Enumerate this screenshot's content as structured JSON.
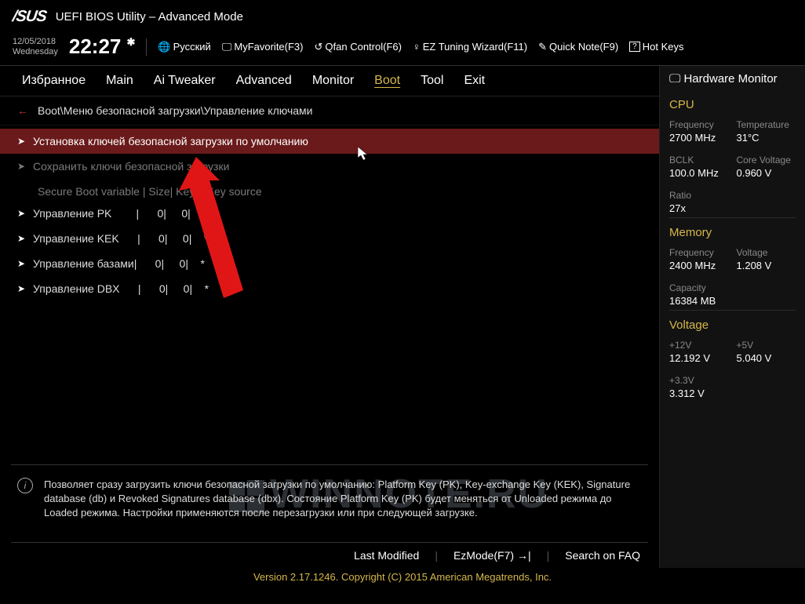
{
  "header": {
    "logo": "/SUS",
    "title": "UEFI BIOS Utility – Advanced Mode"
  },
  "topbar": {
    "date": "12/05/2018",
    "day": "Wednesday",
    "time": "22:27",
    "language": "Русский",
    "links": {
      "favorite": "MyFavorite(F3)",
      "qfan": "Qfan Control(F6)",
      "eztune": "EZ Tuning Wizard(F11)",
      "quicknote": "Quick Note(F9)",
      "hotkeys": "Hot Keys"
    }
  },
  "tabs": {
    "items": [
      "Избранное",
      "Main",
      "Ai Tweaker",
      "Advanced",
      "Monitor",
      "Boot",
      "Tool",
      "Exit"
    ],
    "active": "Boot"
  },
  "breadcrumb": "Boot\\Меню безопасной загрузки\\Управление ключами",
  "rows": {
    "selected": "Установка ключей безопасной загрузки по умолчанию",
    "disabled": "Сохранить ключи безопасной загрузки",
    "table_header": "Secure Boot variable |  Size| Key#| Key source",
    "pk": "Управление PK        |      0|     0|    *",
    "kek": "Управление KEK      |      0|     0|    *",
    "db": "Управление базами|      0|     0|    *",
    "dbx": "Управление DBX      |      0|     0|    *"
  },
  "help": "Позволяет сразу загрузить ключи безопасной загрузки по умолчанию: Platform Key (PK), Key-exchange Key (KEK), Signature database (db) и Revoked Signatures database (dbx). Состояние Platform Key (PK) будет меняться от Unloaded режима до Loaded режима. Настройки применяются после перезагрузки или при следующей загрузке.",
  "footer": {
    "last_modified": "Last Modified",
    "ezmode": "EzMode(F7)",
    "search": "Search on FAQ",
    "copyright": "Version 2.17.1246. Copyright (C) 2015 American Megatrends, Inc."
  },
  "hw": {
    "title": "Hardware Monitor",
    "cpu": {
      "title": "CPU",
      "freq_label": "Frequency",
      "freq": "2700 MHz",
      "temp_label": "Temperature",
      "temp": "31°C",
      "bclk_label": "BCLK",
      "bclk": "100.0 MHz",
      "vcore_label": "Core Voltage",
      "vcore": "0.960 V",
      "ratio_label": "Ratio",
      "ratio": "27x"
    },
    "memory": {
      "title": "Memory",
      "freq_label": "Frequency",
      "freq": "2400 MHz",
      "volt_label": "Voltage",
      "volt": "1.208 V",
      "cap_label": "Capacity",
      "cap": "16384 MB"
    },
    "voltage": {
      "title": "Voltage",
      "v12_label": "+12V",
      "v12": "12.192 V",
      "v5_label": "+5V",
      "v5": "5.040 V",
      "v33_label": "+3.3V",
      "v33": "3.312 V"
    }
  },
  "watermark": "WINNOTE.RU"
}
